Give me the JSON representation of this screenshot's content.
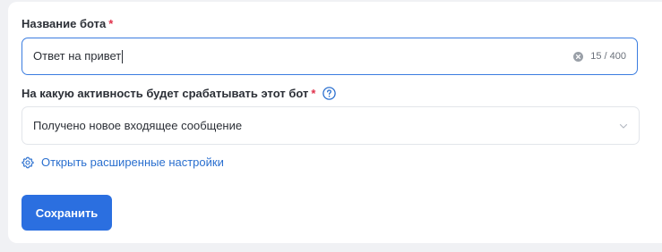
{
  "form": {
    "name_field": {
      "label": "Название бота",
      "required_mark": "*",
      "value": "Ответ на привет",
      "counter": "15 / 400"
    },
    "trigger_field": {
      "label": "На какую активность будет срабатывать этот бот",
      "required_mark": "*",
      "selected": "Получено новое входящее сообщение"
    },
    "advanced_link": "Открыть расширенные настройки",
    "save_button": "Сохранить"
  },
  "colors": {
    "accent": "#2b6fe0",
    "required": "#e0314b",
    "link": "#2a6fcf"
  },
  "icons": {
    "help": "question-circle-icon",
    "clear": "clear-circle-icon",
    "chevron": "chevron-down-icon",
    "gear": "gear-icon"
  }
}
